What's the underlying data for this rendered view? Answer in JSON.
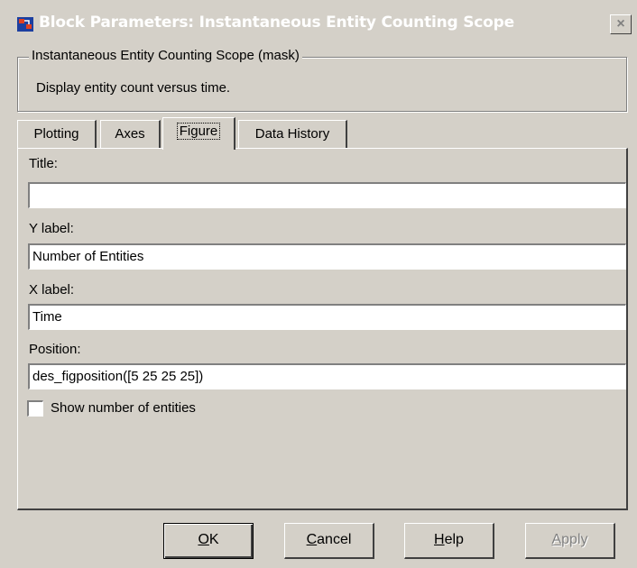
{
  "window": {
    "title": "Block Parameters: Instantaneous Entity Counting Scope",
    "close_glyph": "×"
  },
  "mask": {
    "legend": "Instantaneous Entity Counting Scope (mask)",
    "description": "Display entity count versus time."
  },
  "tabs": [
    {
      "label": "Plotting",
      "active": false
    },
    {
      "label": "Axes",
      "active": false
    },
    {
      "label": "Figure",
      "active": true
    },
    {
      "label": "Data History",
      "active": false
    }
  ],
  "fields": {
    "title": {
      "label": "Title:",
      "value": ""
    },
    "ylabel": {
      "label": "Y label:",
      "value": "Number of Entities"
    },
    "xlabel": {
      "label": "X label:",
      "value": "Time"
    },
    "position": {
      "label": "Position:",
      "value": "des_figposition([5 25 25 25])"
    }
  },
  "checkbox": {
    "label": "Show number of entities",
    "checked": false
  },
  "buttons": {
    "ok": {
      "mnemonic": "O",
      "rest": "K"
    },
    "cancel": {
      "mnemonic": "C",
      "rest": "ancel"
    },
    "help": {
      "mnemonic": "H",
      "rest": "elp"
    },
    "apply": {
      "mnemonic": "A",
      "rest": "pply",
      "enabled": false
    }
  },
  "colors": {
    "dialog_bg": "#d4d0c8",
    "title_text": "#ffffff",
    "disabled_text": "#808080"
  }
}
